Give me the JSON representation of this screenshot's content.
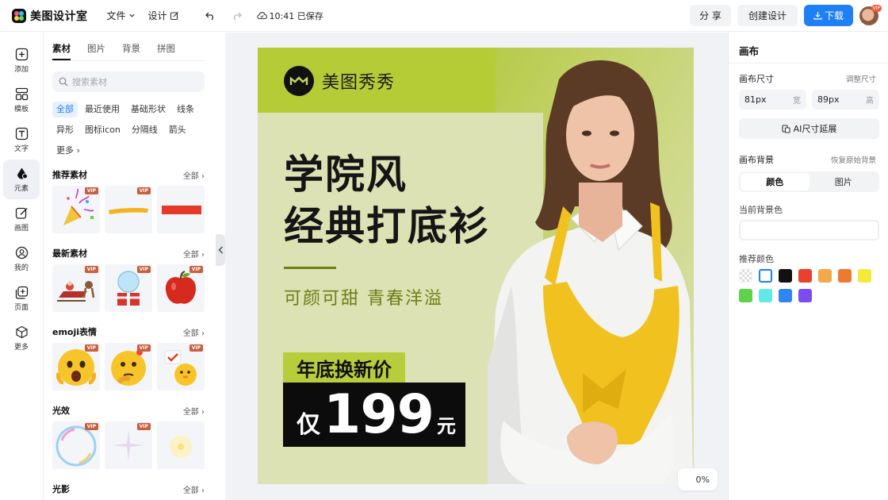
{
  "app": {
    "title": "美图设计室"
  },
  "topbar": {
    "menu_file": "文件",
    "menu_design": "设计",
    "saved_status": "10:41 已保存",
    "share_label": "分 享",
    "create_label": "创建设计",
    "download_label": "下载",
    "avatar_badge": "VIP"
  },
  "rail": {
    "items": [
      {
        "label": "添加"
      },
      {
        "label": "模板"
      },
      {
        "label": "文字"
      },
      {
        "label": "元素"
      },
      {
        "label": "画图"
      },
      {
        "label": "我的"
      },
      {
        "label": "页面"
      },
      {
        "label": "更多"
      }
    ]
  },
  "panel": {
    "tabs": [
      "素材",
      "图片",
      "背景",
      "拼图"
    ],
    "search_placeholder": "搜索素材",
    "chips": [
      "全部",
      "最近使用",
      "基础形状",
      "线条",
      "异形",
      "图标icon",
      "分隔线",
      "箭头",
      "更多"
    ],
    "vip_badge": "VIP",
    "sections": [
      {
        "title": "推荐素材",
        "all": "全部"
      },
      {
        "title": "最新素材",
        "all": "全部"
      },
      {
        "title": "emoji表情",
        "all": "全部"
      },
      {
        "title": "光效",
        "all": "全部"
      },
      {
        "title": "光影",
        "all": "全部"
      }
    ]
  },
  "canvas": {
    "brand": "美图秀秀",
    "headline_1": "学院风",
    "headline_2": "经典打底衫",
    "subline": "可颜可甜  青春洋溢",
    "tag": "年底换新价",
    "price_prefix": "仅",
    "price_value": "199",
    "price_unit": "元",
    "zoom": "0%"
  },
  "props": {
    "title": "画布",
    "size_label": "画布尺寸",
    "size_link": "调整尺寸",
    "width_value": "81px",
    "width_unit": "宽",
    "height_value": "89px",
    "height_unit": "高",
    "ai_button": "AI尺寸延展",
    "bg_label": "画布背景",
    "bg_link": "恢复原始背景",
    "seg_color": "颜色",
    "seg_image": "图片",
    "current_bg_label": "当前背景色",
    "recommend_label": "推荐颜色",
    "swatches": [
      "transparent",
      "#ffffff",
      "#111111",
      "#e8412c",
      "#f2a94a",
      "#ee7a2f",
      "#f4ea3c",
      "#5ed24a",
      "#62e8e8",
      "#2f86f2",
      "#7b4cf0"
    ]
  }
}
